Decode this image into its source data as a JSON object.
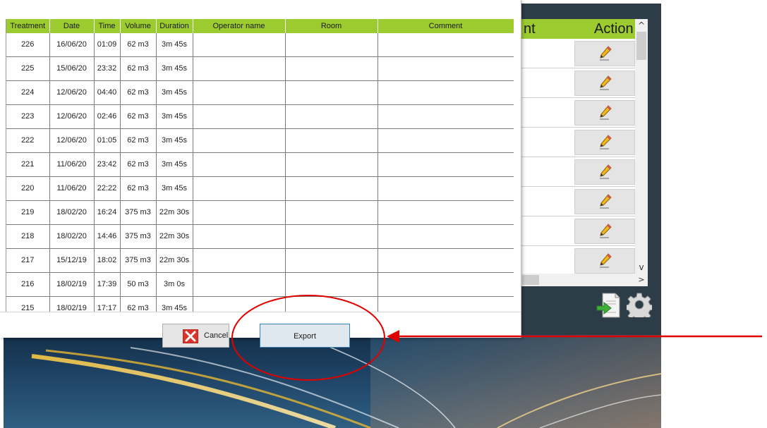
{
  "background_window": {
    "header": {
      "col_partial": "nt",
      "col_action": "Action"
    },
    "rows_count": 8,
    "scroll": {
      "up": "^",
      "down": "v",
      "right": ">"
    }
  },
  "dialog": {
    "columns": [
      "Treatment",
      "Date",
      "Time",
      "Volume",
      "Duration",
      "Operator name",
      "Room",
      "Comment"
    ],
    "rows": [
      {
        "treatment": "226",
        "date": "16/06/20",
        "time": "01:09",
        "volume": "62 m3",
        "duration": "3m 45s",
        "operator": "",
        "room": "",
        "comment": ""
      },
      {
        "treatment": "225",
        "date": "15/06/20",
        "time": "23:32",
        "volume": "62 m3",
        "duration": "3m 45s",
        "operator": "",
        "room": "",
        "comment": ""
      },
      {
        "treatment": "224",
        "date": "12/06/20",
        "time": "04:40",
        "volume": "62 m3",
        "duration": "3m 45s",
        "operator": "",
        "room": "",
        "comment": ""
      },
      {
        "treatment": "223",
        "date": "12/06/20",
        "time": "02:46",
        "volume": "62 m3",
        "duration": "3m 45s",
        "operator": "",
        "room": "",
        "comment": ""
      },
      {
        "treatment": "222",
        "date": "12/06/20",
        "time": "01:05",
        "volume": "62 m3",
        "duration": "3m 45s",
        "operator": "",
        "room": "",
        "comment": ""
      },
      {
        "treatment": "221",
        "date": "11/06/20",
        "time": "23:42",
        "volume": "62 m3",
        "duration": "3m 45s",
        "operator": "",
        "room": "",
        "comment": ""
      },
      {
        "treatment": "220",
        "date": "11/06/20",
        "time": "22:22",
        "volume": "62 m3",
        "duration": "3m 45s",
        "operator": "",
        "room": "",
        "comment": ""
      },
      {
        "treatment": "219",
        "date": "18/02/20",
        "time": "16:24",
        "volume": "375 m3",
        "duration": "22m 30s",
        "operator": "",
        "room": "",
        "comment": ""
      },
      {
        "treatment": "218",
        "date": "18/02/20",
        "time": "14:46",
        "volume": "375 m3",
        "duration": "22m 30s",
        "operator": "",
        "room": "",
        "comment": ""
      },
      {
        "treatment": "217",
        "date": "15/12/19",
        "time": "18:02",
        "volume": "375 m3",
        "duration": "22m 30s",
        "operator": "",
        "room": "",
        "comment": ""
      },
      {
        "treatment": "216",
        "date": "18/02/19",
        "time": "17:39",
        "volume": "50 m3",
        "duration": "3m 0s",
        "operator": "",
        "room": "",
        "comment": ""
      },
      {
        "treatment": "215",
        "date": "18/02/19",
        "time": "17:17",
        "volume": "62 m3",
        "duration": "3m 45s",
        "operator": "",
        "room": "",
        "comment": ""
      }
    ],
    "buttons": {
      "cancel": "Cancel",
      "export": "Export"
    }
  },
  "colors": {
    "header_green": "#9ccb2f",
    "annotation_red": "#e00000",
    "app_dark": "#2d3d48"
  },
  "icons": {
    "edit": "pencil-icon",
    "cancel": "red-x-icon",
    "export_doc": "document-export-icon",
    "settings": "gear-icon"
  }
}
